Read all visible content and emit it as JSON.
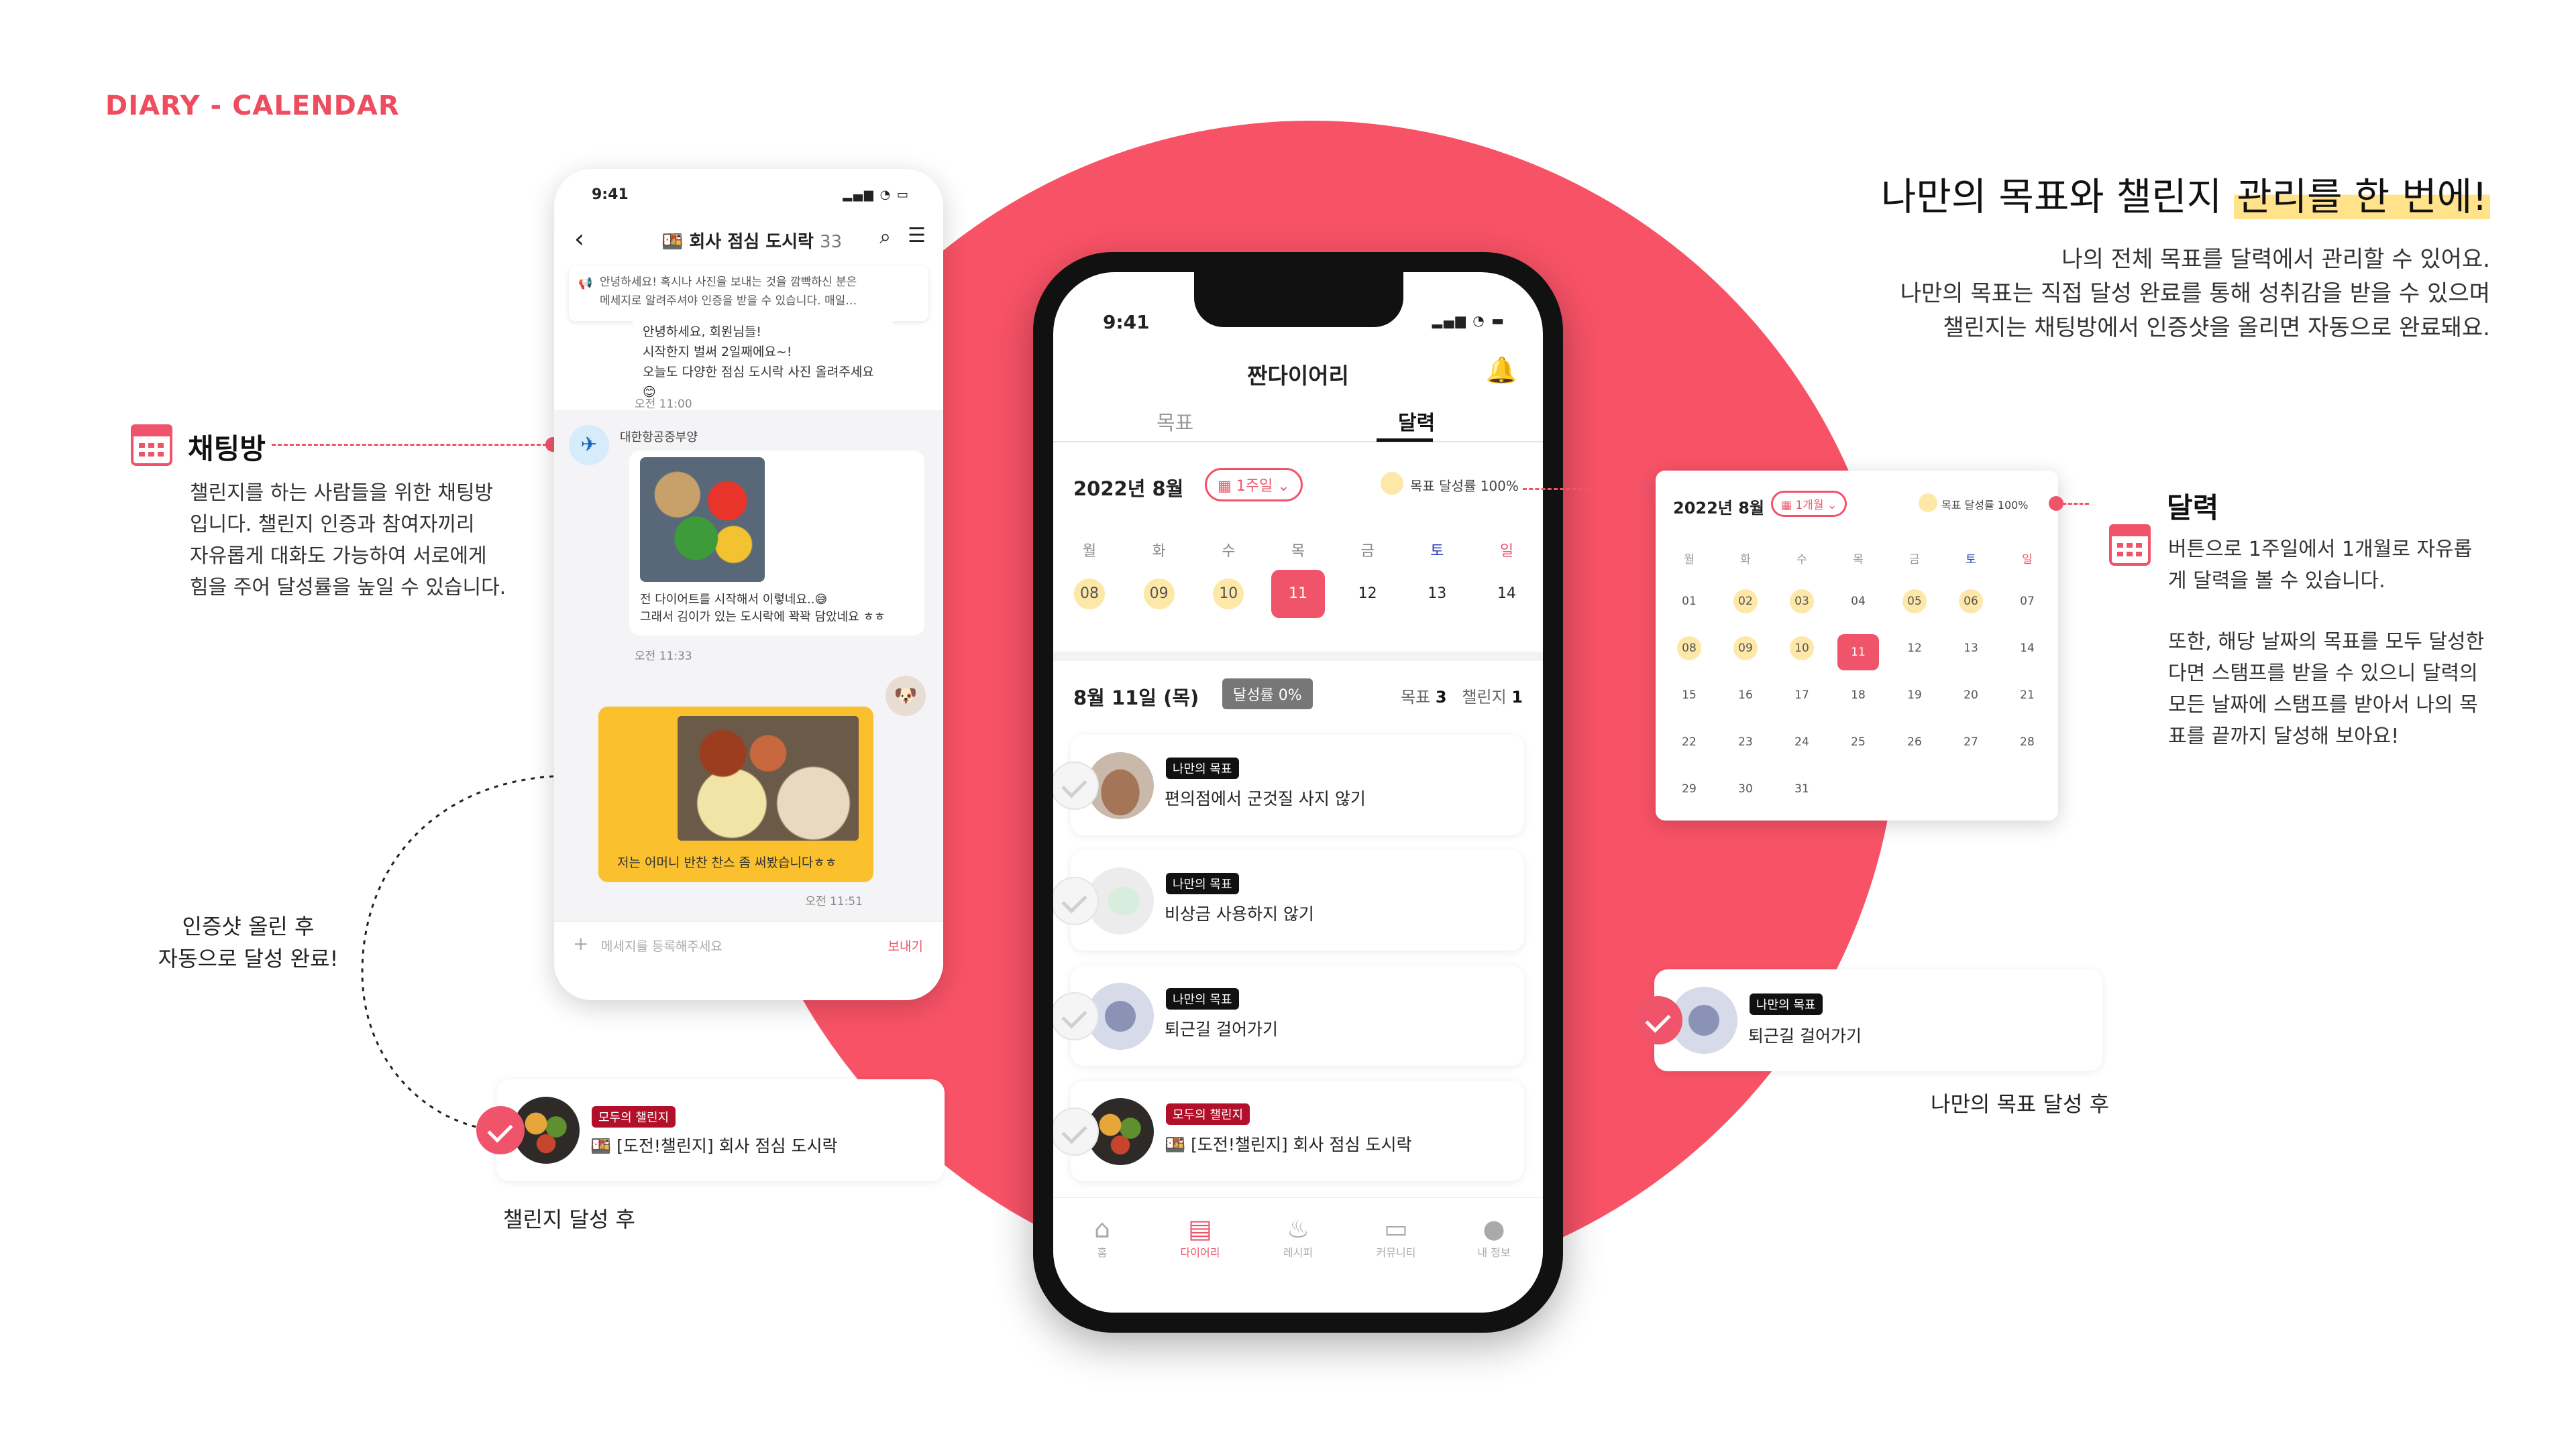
{
  "section_title": "DIARY - CALENDAR",
  "headline": {
    "part1": "나만의 목표와 챌린지 ",
    "highlight": "관리를 한 번에!"
  },
  "description": [
    "나의 전체 목표를 달력에서 관리할 수 있어요.",
    "나만의 목표는 직접 달성 완료를 통해 성취감을 받을 수 있으며",
    "챌린지는 채팅방에서 인증샷을 올리면 자동으로 완료돼요."
  ],
  "annotations": {
    "chat": {
      "title": "채팅방",
      "body": [
        "챌린지를 하는 사람들을 위한 채팅방",
        "입니다. 챌린지 인증과 참여자끼리",
        "자유롭게 대화도 가능하여 서로에게",
        "힘을 주어 달성률을 높일 수 있습니다."
      ]
    },
    "auto": [
      "인증샷 올린 후",
      "자동으로 달성 완료!"
    ],
    "calendar": {
      "title": "달력",
      "body": [
        "버튼으로 1주일에서 1개월로 자유롭",
        "게 달력을 볼 수 있습니다.",
        "",
        "또한, 해당 날짜의 목표를 모두 달성한",
        "다면 스탬프를 받을 수 있으니 달력의",
        "모든 날짜에 스탬프를 받아서 나의 목",
        "표를 끝까지 달성해 보아요!"
      ]
    },
    "challenge_done_caption": "챌린지 달성 후",
    "goal_done_caption": "나만의 목표 달성 후"
  },
  "chat_phone": {
    "time": "9:41",
    "room_title": "🍱 회사 점심 도시락",
    "member_count": "33",
    "notice": [
      "안녕하세요! 혹시나 사진을 보내는 것을 깜빡하신 분은",
      "메세지로 알려주셔야 인증을 받을 수 있습니다. 매일…"
    ],
    "msg1": [
      "안녕하세요, 회원님들!",
      "시작한지 벌써 2일째에요~!",
      "오늘도 다양한 점심 도시락 사진 올려주세요😊"
    ],
    "msg1_time": "오전 11:00",
    "sender2": "대한항공중부양",
    "msg2": [
      "전 다이어트를 시작해서 이렇네요..😅",
      "그래서 김이가 있는 도시락에 꽉꽉 담았네요 ㅎㅎ"
    ],
    "msg2_time": "오전 11:33",
    "my_msg": "저는 어머니 반찬 찬스 좀 써봤습니다ㅎㅎ",
    "my_msg_time": "오전 11:51",
    "input_placeholder": "메세지를 등록해주세요",
    "send_label": "보내기"
  },
  "main_phone": {
    "time": "9:41",
    "app_title": "짠다이어리",
    "tabs": [
      "목표",
      "달력"
    ],
    "month": "2022년 8월",
    "range_chip": "1주일",
    "legend": "목표 달성률 100%",
    "weekdays": [
      "월",
      "화",
      "수",
      "목",
      "금",
      "토",
      "일"
    ],
    "week": [
      "08",
      "09",
      "10",
      "11",
      "12",
      "13",
      "14"
    ],
    "stamped_days": [
      "08",
      "09",
      "10"
    ],
    "selected_day": "11",
    "date_label": "8월 11일 (목)",
    "rate_label": "달성률 0%",
    "goal_count_label": "목표",
    "goal_count": "3",
    "challenge_count_label": "챌린지",
    "challenge_count": "1",
    "items": [
      {
        "badge": "나만의 목표",
        "text": "편의점에서 군것질 사지 않기",
        "type": "goal",
        "done": false
      },
      {
        "badge": "나만의 목표",
        "text": "비상금 사용하지 않기",
        "type": "goal",
        "done": false
      },
      {
        "badge": "나만의 목표",
        "text": "퇴근길 걸어가기",
        "type": "goal",
        "done": false
      },
      {
        "badge": "모두의 챌린지",
        "text": "🍱 [도전!챌린지] 회사 점심 도시락",
        "type": "challenge",
        "done": false
      }
    ],
    "nav": [
      "홈",
      "다이어리",
      "레시피",
      "커뮤니티",
      "내 정보"
    ]
  },
  "side_calendar": {
    "month": "2022년 8월",
    "range_chip": "1개월",
    "legend": "목표 달성률 100%",
    "weekdays": [
      "월",
      "화",
      "수",
      "목",
      "금",
      "토",
      "일"
    ],
    "weeks": [
      [
        "01",
        "02",
        "03",
        "04",
        "05",
        "06",
        "07"
      ],
      [
        "08",
        "09",
        "10",
        "11",
        "12",
        "13",
        "14"
      ],
      [
        "15",
        "16",
        "17",
        "18",
        "19",
        "20",
        "21"
      ],
      [
        "22",
        "23",
        "24",
        "25",
        "26",
        "27",
        "28"
      ],
      [
        "29",
        "30",
        "31",
        "",
        "",
        "",
        ""
      ]
    ],
    "stamped_days": [
      "02",
      "03",
      "05",
      "06",
      "08",
      "09",
      "10"
    ],
    "selected_day": "11"
  },
  "challenge_done_card": {
    "badge": "모두의 챌린지",
    "text": "🍱 [도전!챌린지] 회사 점심 도시락",
    "done": true
  },
  "goal_done_card": {
    "badge": "나만의 목표",
    "text": "퇴근길 걸어가기",
    "done": true
  },
  "colors": {
    "accent": "#f0546b",
    "circle": "#f85266",
    "stamp": "#fde8a8",
    "chat_mine": "#fbc02d"
  }
}
